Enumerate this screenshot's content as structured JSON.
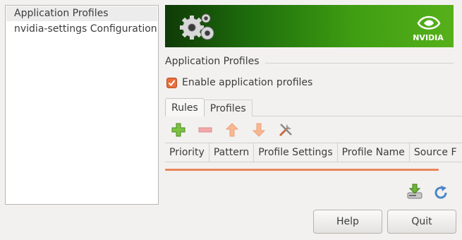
{
  "sidebar": {
    "items": [
      {
        "label": "Application Profiles",
        "selected": true
      },
      {
        "label": "nvidia-settings Configuration",
        "selected": false
      }
    ]
  },
  "banner": {
    "logo_text": "NVIDIA",
    "colors": {
      "dark": "#0f3a07",
      "light": "#56b01a"
    }
  },
  "section": {
    "title": "Application Profiles"
  },
  "enable_checkbox": {
    "label": "Enable application profiles",
    "checked": true,
    "color": "#e86e3c"
  },
  "tabs": [
    {
      "label": "Rules",
      "active": true
    },
    {
      "label": "Profiles",
      "active": false
    }
  ],
  "toolbar": {
    "icons": [
      "add-icon",
      "remove-icon",
      "move-up-icon",
      "move-down-icon",
      "edit-icon"
    ]
  },
  "table": {
    "columns": [
      "Priority",
      "Pattern",
      "Profile Settings",
      "Profile Name",
      "Source F"
    ]
  },
  "actions": {
    "icons": [
      "save-icon",
      "reload-icon"
    ]
  },
  "buttons": {
    "help": "Help",
    "quit": "Quit"
  }
}
